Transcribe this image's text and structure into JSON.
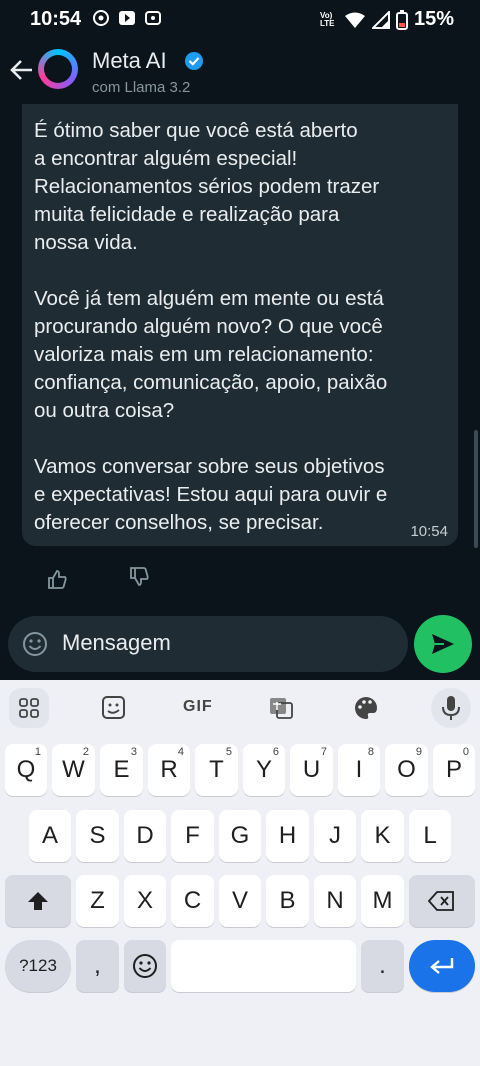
{
  "status": {
    "time": "10:54",
    "battery": "15%",
    "volte": "Vo) LTE"
  },
  "header": {
    "name": "Meta AI",
    "subtitle": "com Llama 3.2"
  },
  "message": {
    "paragraph1": "É ótimo saber que você está aberto\na encontrar alguém especial!\nRelacionamentos sérios podem trazer\nmuita felicidade e realização para\nnossa vida.",
    "paragraph2": "Você já tem alguém em mente ou está\nprocurando alguém novo? O que você\nvaloriza mais em um relacionamento:\nconfiança, comunicação, apoio, paixão\nou outra coisa?",
    "paragraph3": "Vamos conversar sobre seus objetivos\ne expectativas! Estou aqui para ouvir e\noferecer conselhos, se precisar.",
    "time": "10:54"
  },
  "composer": {
    "placeholder": "Mensagem"
  },
  "keyboard": {
    "toolbar": {
      "gif": "GIF"
    },
    "row1": [
      {
        "k": "Q",
        "n": "1"
      },
      {
        "k": "W",
        "n": "2"
      },
      {
        "k": "E",
        "n": "3"
      },
      {
        "k": "R",
        "n": "4"
      },
      {
        "k": "T",
        "n": "5"
      },
      {
        "k": "Y",
        "n": "6"
      },
      {
        "k": "U",
        "n": "7"
      },
      {
        "k": "I",
        "n": "8"
      },
      {
        "k": "O",
        "n": "9"
      },
      {
        "k": "P",
        "n": "0"
      }
    ],
    "row2": [
      "A",
      "S",
      "D",
      "F",
      "G",
      "H",
      "J",
      "K",
      "L"
    ],
    "row3": [
      "Z",
      "X",
      "C",
      "V",
      "B",
      "N",
      "M"
    ],
    "symbols": "?123",
    "comma": ",",
    "period": "."
  }
}
